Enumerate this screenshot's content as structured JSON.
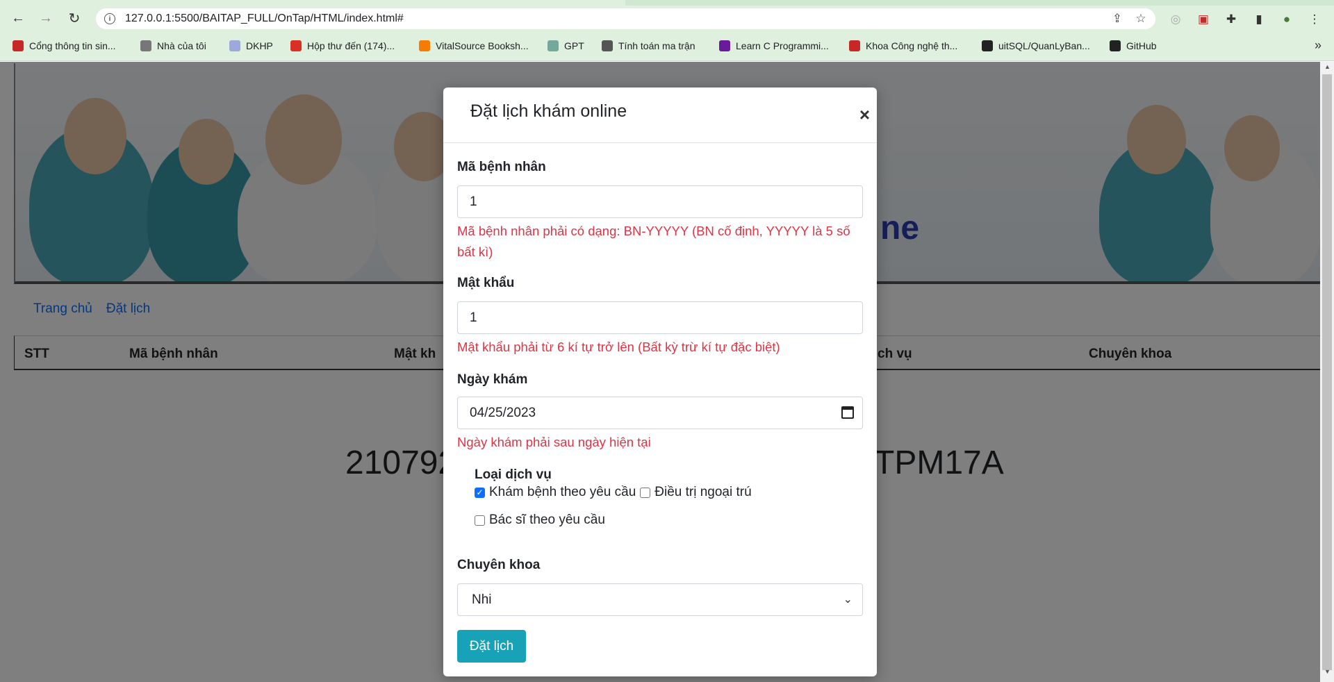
{
  "browser": {
    "url": "127.0.0.1:5500/BAITAP_FULL/OnTap/HTML/index.html#",
    "bookmarks": [
      {
        "label": "Cổng thông tin sin...",
        "icon": "uit-logo-icon",
        "color": "#c62828"
      },
      {
        "label": "Nhà của tôi",
        "icon": "moodle-icon",
        "color": "#777777"
      },
      {
        "label": "DKHP",
        "icon": "document-icon",
        "color": "#9fa8da"
      },
      {
        "label": "Hộp thư đến (174)...",
        "icon": "gmail-icon",
        "color": "#d93025"
      },
      {
        "label": "VitalSource Booksh...",
        "icon": "vitalsource-icon",
        "color": "#f57c00"
      },
      {
        "label": "GPT",
        "icon": "openai-icon",
        "color": "#74a89a"
      },
      {
        "label": "Tính toán ma trận",
        "icon": "matrix-icon",
        "color": "#555555"
      },
      {
        "label": "Learn C Programmi...",
        "icon": "learn-c-icon",
        "color": "#6a1b9a"
      },
      {
        "label": "Khoa Công nghệ th...",
        "icon": "uit-logo-icon",
        "color": "#c62828"
      },
      {
        "label": "uitSQL/QuanLyBan...",
        "icon": "github-icon",
        "color": "#222222"
      },
      {
        "label": "GitHub",
        "icon": "github-icon",
        "color": "#222222"
      }
    ]
  },
  "page": {
    "nav": [
      "Trang chủ",
      "Đặt lịch"
    ],
    "table_headers": [
      "STT",
      "Mã bệnh nhân",
      "Mật kh",
      "ch vụ",
      "Chuyên khoa"
    ],
    "banner_partial_text": "ne",
    "footer_left": "210792",
    "footer_right": "TPM17A"
  },
  "modal": {
    "title": "Đặt lịch khám online",
    "close": "×",
    "patient_id": {
      "label": "Mã bệnh nhân",
      "value": "1",
      "error": "Mã bệnh nhân phải có dạng: BN-YYYYY (BN cố định, YYYYY là 5 số bất kì)"
    },
    "password": {
      "label": "Mật khẩu",
      "value": "1",
      "error": "Mật khẩu phải từ 6 kí tự trở lên (Bất kỳ trừ kí tự đặc biệt)"
    },
    "date": {
      "label": "Ngày khám",
      "value": "04/25/2023",
      "error": "Ngày khám phải sau ngày hiện tại"
    },
    "service": {
      "label": "Loại dịch vụ",
      "options": [
        {
          "label": "Khám bệnh theo yêu cầu",
          "checked": true
        },
        {
          "label": "Điều trị ngoại trú",
          "checked": false
        },
        {
          "label": "Bác sĩ theo yêu cầu",
          "checked": false
        }
      ]
    },
    "specialty": {
      "label": "Chuyên khoa",
      "value": "Nhi"
    },
    "submit": "Đặt lịch"
  },
  "colors": {
    "error": "#dc3545",
    "submit_bg": "#17a2b8",
    "link": "#0d6efd",
    "browser_chrome": "#dff0de"
  }
}
